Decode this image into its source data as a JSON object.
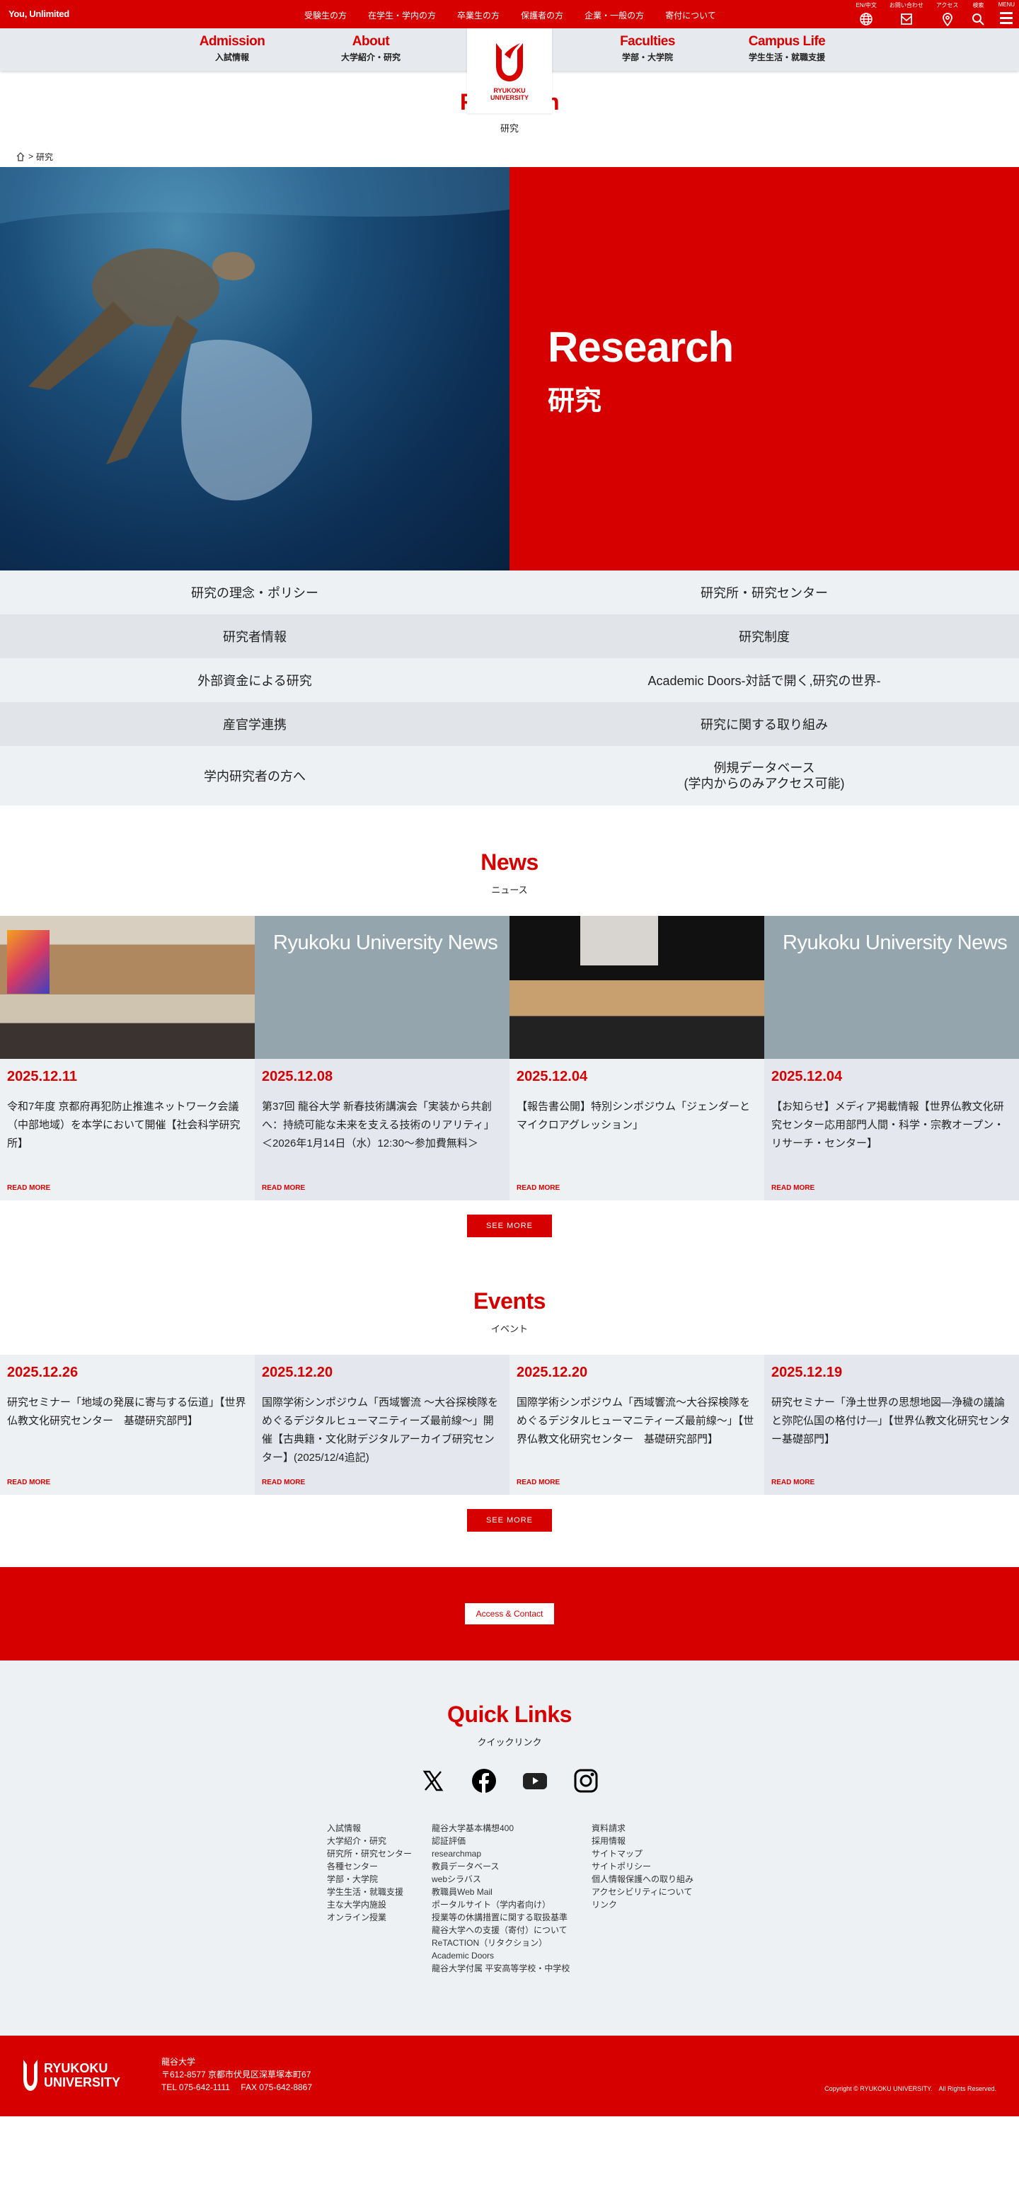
{
  "topbar": {
    "brand": "You, Unlimited",
    "audience": [
      "受験生の方",
      "在学生・学内の方",
      "卒業生の方",
      "保護者の方",
      "企業・一般の方",
      "寄付について"
    ],
    "utils": [
      {
        "label": "EN/中文",
        "icon": "globe-icon"
      },
      {
        "label": "お問い合わせ",
        "icon": "mail-icon"
      },
      {
        "label": "アクセス",
        "icon": "map-pin-icon"
      },
      {
        "label": "検索",
        "icon": "search-icon"
      },
      {
        "label": "MENU",
        "icon": "hamburger-icon"
      }
    ]
  },
  "nav": [
    {
      "en": "Admission",
      "jp": "入試情報"
    },
    {
      "en": "About",
      "jp": "大学紹介・研究"
    },
    {
      "en": "Faculties",
      "jp": "学部・大学院"
    },
    {
      "en": "Campus Life",
      "jp": "学生生活・就職支援"
    }
  ],
  "logo": {
    "line1": "RYUKOKU",
    "line2": "UNIVERSITY"
  },
  "page": {
    "title": "Research",
    "subtitle": "研究"
  },
  "breadcrumb": {
    "sep": ">",
    "current": "研究"
  },
  "hero": {
    "title": "Research",
    "subtitle": "研究"
  },
  "links": [
    [
      "研究の理念・ポリシー",
      "研究所・研究センター"
    ],
    [
      "研究者情報",
      "研究制度"
    ],
    [
      "外部資金による研究",
      "Academic Doors-対話で開く,研究の世界-"
    ],
    [
      "産官学連携",
      "研究に関する取り組み"
    ],
    [
      "学内研究者の方へ",
      "例規データベース\n(学内からのみアクセス可能)"
    ]
  ],
  "news": {
    "title": "News",
    "subtitle": "ニュース",
    "placeholder": "Ryukoku University News",
    "read_more": "READ MORE",
    "see_more": "SEE MORE",
    "items": [
      {
        "date": "2025.12.11",
        "text": "令和7年度 京都府再犯防止推進ネットワーク会議（中部地域）を本学において開催【社会科学研究所】"
      },
      {
        "date": "2025.12.08",
        "text": "第37回 龍谷大学 新春技術講演会「実装から共創へ：持続可能な未来を支える技術のリアリティ」＜2026年1月14日（水）12:30～参加費無料＞"
      },
      {
        "date": "2025.12.04",
        "text": "【報告書公開】特別シンポジウム「ジェンダーとマイクロアグレッション」"
      },
      {
        "date": "2025.12.04",
        "text": "【お知らせ】メディア掲載情報【世界仏教文化研究センター応用部門人間・科学・宗教オープン・リサーチ・センター】"
      }
    ]
  },
  "events": {
    "title": "Events",
    "subtitle": "イベント",
    "read_more": "READ MORE",
    "see_more": "SEE MORE",
    "items": [
      {
        "date": "2025.12.26",
        "text": "研究セミナー「地域の発展に寄与する伝道」【世界仏教文化研究センター　基礎研究部門】"
      },
      {
        "date": "2025.12.20",
        "text": "国際学術シンポジウム「西域響流 ～大谷探検隊をめぐるデジタルヒューマニティーズ最前線～」開催【古典籍・文化財デジタルアーカイブ研究センター】(2025/12/4追記)"
      },
      {
        "date": "2025.12.20",
        "text": "国際学術シンポジウム「西域響流～大谷探検隊をめぐるデジタルヒューマニティーズ最前線～」【世界仏教文化研究センター　基礎研究部門】"
      },
      {
        "date": "2025.12.19",
        "text": "研究セミナー「浄土世界の思想地図―浄穢の議論と弥陀仏国の格付け―」【世界仏教文化研究センター基礎部門】"
      }
    ]
  },
  "access": {
    "label": "Access & Contact"
  },
  "quick": {
    "title": "Quick Links",
    "subtitle": "クイックリンク",
    "social": [
      "x-icon",
      "facebook-icon",
      "youtube-icon",
      "instagram-icon"
    ],
    "columns": [
      [
        "入試情報",
        "大学紹介・研究",
        "研究所・研究センター",
        "各種センター",
        "学部・大学院",
        "学生生活・就職支援",
        "主な大学内施設",
        "オンライン授業"
      ],
      [
        "龍谷大学基本構想400",
        "認証評価",
        "researchmap",
        "教員データベース",
        "webシラバス",
        "教職員Web Mail",
        "ポータルサイト（学内者向け）",
        "授業等の休講措置に関する取扱基準",
        "龍谷大学への支援（寄付）について",
        "ReTACTION（リタクション）",
        "Academic Doors",
        "龍谷大学付属 平安高等学校・中学校"
      ],
      [
        "資料請求",
        "採用情報",
        "サイトマップ",
        "サイトポリシー",
        "個人情報保護への取り組み",
        "アクセシビリティについて",
        "リンク"
      ]
    ]
  },
  "footer": {
    "logo1": "RYUKOKU",
    "logo2": "UNIVERSITY",
    "name": "龍谷大学",
    "address": "〒612-8577 京都市伏見区深草塚本町67",
    "tel": "TEL 075-642-1111　 FAX 075-642-8867",
    "copyright": "Copyright © RYUKOKU UNIVERSITY.　All Rights Reserved."
  },
  "colors": {
    "brand": "#d70000",
    "nav_bg": "#e6e9ed",
    "light_bg": "#eef1f4"
  }
}
